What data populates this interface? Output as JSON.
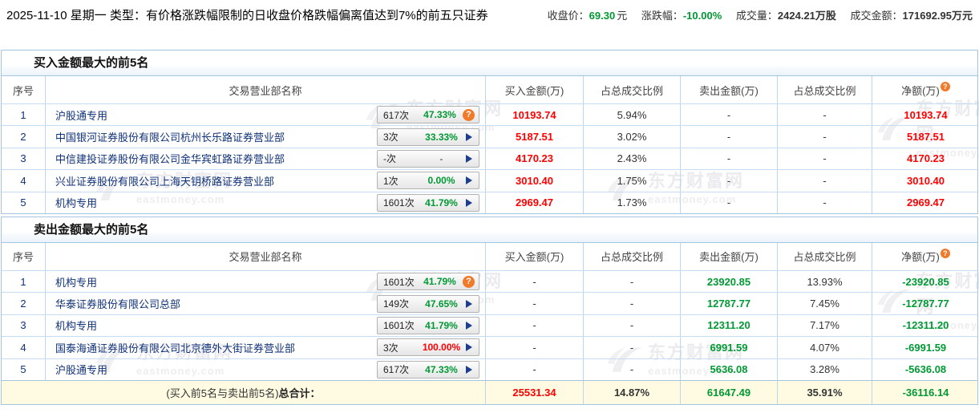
{
  "header": {
    "title": "2025-11-10 星期一 类型：有价格涨跌幅限制的日收盘价格跌幅偏离值达到7%的前五只证券",
    "stats": [
      {
        "label": "收盘价：",
        "value": "69.30",
        "unit": "元",
        "value_class": "green"
      },
      {
        "label": "涨跌幅：",
        "value": "-10.00%",
        "unit": "",
        "value_class": "green"
      },
      {
        "label": "成交量：",
        "value": "2424.21万股",
        "unit": "",
        "value_class": "dark"
      },
      {
        "label": "成交金额：",
        "value": "171692.95万元",
        "unit": "",
        "value_class": "dark"
      }
    ]
  },
  "columns": [
    "序号",
    "交易营业部名称",
    "买入金额(万)",
    "占总成交比例",
    "卖出金额(万)",
    "占总成交比例",
    "净额(万)"
  ],
  "buy": {
    "title": "买入金额最大的前5名",
    "rows": [
      {
        "no": "1",
        "name": "沪股通专用",
        "count": "617次",
        "pct": "47.33%",
        "pct_class": "green",
        "icon": "icon-help",
        "buy": "10193.74",
        "buy_class": "red",
        "buy_pct": "5.94%",
        "sell": "-",
        "sell_class": "dark",
        "sell_pct": "-",
        "net": "10193.74",
        "net_class": "red"
      },
      {
        "no": "2",
        "name": "中国银河证券股份有限公司杭州长乐路证券营业部",
        "count": "3次",
        "pct": "33.33%",
        "pct_class": "green",
        "icon": "icon-arrow",
        "buy": "5187.51",
        "buy_class": "red",
        "buy_pct": "3.02%",
        "sell": "-",
        "sell_class": "dark",
        "sell_pct": "-",
        "net": "5187.51",
        "net_class": "red"
      },
      {
        "no": "3",
        "name": "中信建投证券股份有限公司金华宾虹路证券营业部",
        "count": "-次",
        "pct": "-",
        "pct_class": "dark",
        "icon": "icon-arrow",
        "buy": "4170.23",
        "buy_class": "red",
        "buy_pct": "2.43%",
        "sell": "-",
        "sell_class": "dark",
        "sell_pct": "-",
        "net": "4170.23",
        "net_class": "red"
      },
      {
        "no": "4",
        "name": "兴业证券股份有限公司上海天钥桥路证券营业部",
        "count": "1次",
        "pct": "0.00%",
        "pct_class": "green",
        "icon": "icon-arrow",
        "buy": "3010.40",
        "buy_class": "red",
        "buy_pct": "1.75%",
        "sell": "-",
        "sell_class": "dark",
        "sell_pct": "-",
        "net": "3010.40",
        "net_class": "red"
      },
      {
        "no": "5",
        "name": "机构专用",
        "count": "1601次",
        "pct": "41.79%",
        "pct_class": "green",
        "icon": "icon-arrow",
        "buy": "2969.47",
        "buy_class": "red",
        "buy_pct": "1.73%",
        "sell": "-",
        "sell_class": "dark",
        "sell_pct": "-",
        "net": "2969.47",
        "net_class": "red"
      }
    ]
  },
  "sell": {
    "title": "卖出金额最大的前5名",
    "rows": [
      {
        "no": "1",
        "name": "机构专用",
        "count": "1601次",
        "pct": "41.79%",
        "pct_class": "green",
        "icon": "icon-help",
        "buy": "-",
        "buy_class": "dark",
        "buy_pct": "-",
        "sell": "23920.85",
        "sell_class": "green",
        "sell_pct": "13.93%",
        "net": "-23920.85",
        "net_class": "green"
      },
      {
        "no": "2",
        "name": "华泰证券股份有限公司总部",
        "count": "149次",
        "pct": "47.65%",
        "pct_class": "green",
        "icon": "icon-arrow",
        "buy": "-",
        "buy_class": "dark",
        "buy_pct": "-",
        "sell": "12787.77",
        "sell_class": "green",
        "sell_pct": "7.45%",
        "net": "-12787.77",
        "net_class": "green"
      },
      {
        "no": "3",
        "name": "机构专用",
        "count": "1601次",
        "pct": "41.79%",
        "pct_class": "green",
        "icon": "icon-arrow",
        "buy": "-",
        "buy_class": "dark",
        "buy_pct": "-",
        "sell": "12311.20",
        "sell_class": "green",
        "sell_pct": "7.17%",
        "net": "-12311.20",
        "net_class": "green"
      },
      {
        "no": "4",
        "name": "国泰海通证券股份有限公司北京德外大街证券营业部",
        "count": "3次",
        "pct": "100.00%",
        "pct_class": "red",
        "icon": "icon-arrow",
        "buy": "-",
        "buy_class": "dark",
        "buy_pct": "-",
        "sell": "6991.59",
        "sell_class": "green",
        "sell_pct": "4.07%",
        "net": "-6991.59",
        "net_class": "green"
      },
      {
        "no": "5",
        "name": "沪股通专用",
        "count": "617次",
        "pct": "47.33%",
        "pct_class": "green",
        "icon": "icon-arrow",
        "buy": "-",
        "buy_class": "dark",
        "buy_pct": "-",
        "sell": "5636.08",
        "sell_class": "green",
        "sell_pct": "3.28%",
        "net": "-5636.08",
        "net_class": "green"
      }
    ],
    "footer": {
      "label_plain": "(买入前5名与卖出前5名)",
      "label_strong": "总合计：",
      "buy": "25531.34",
      "buy_class": "red",
      "buy_pct": "14.87%",
      "sell": "61647.49",
      "sell_class": "green",
      "sell_pct": "35.91%",
      "net": "-36116.14",
      "net_class": "green"
    }
  },
  "watermark": {
    "line1": "东方财富网",
    "line2": "eastmoney.com"
  }
}
